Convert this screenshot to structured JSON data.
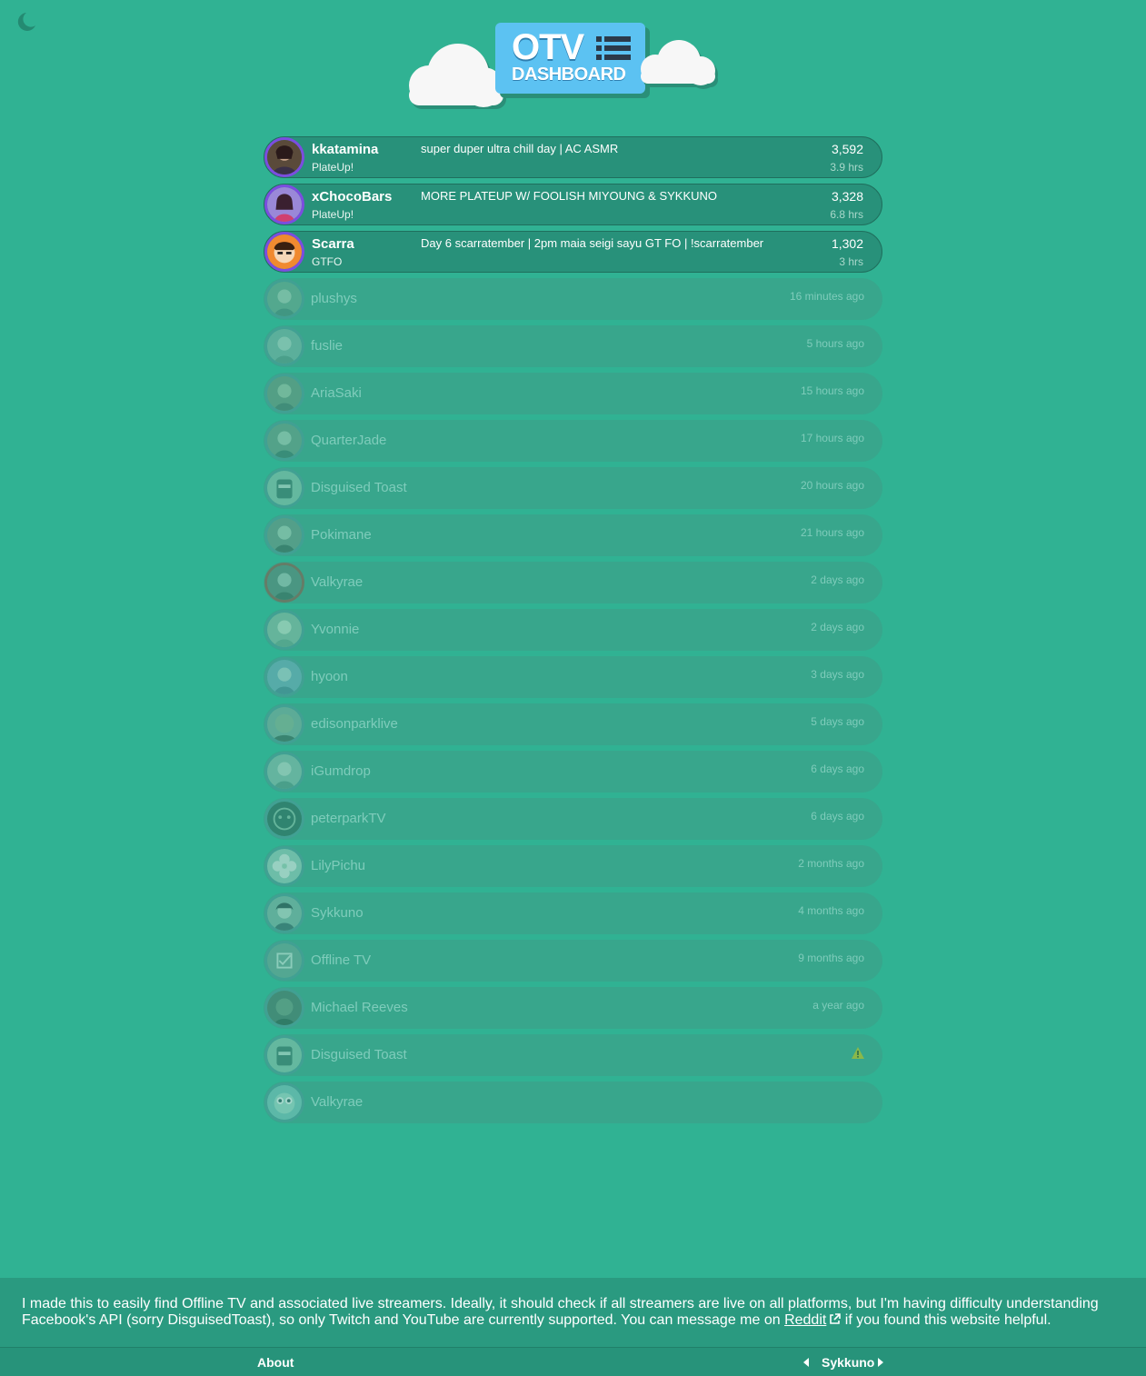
{
  "header": {
    "logo_line1": "OTV",
    "logo_line2": "DASHBOARD"
  },
  "live": [
    {
      "name": "kkatamina",
      "game": "PlateUp!",
      "title": "super duper ultra chill day | AC ASMR",
      "viewers": "3,592",
      "uptime": "3.9 hrs"
    },
    {
      "name": "xChocoBars",
      "game": "PlateUp!",
      "title": "MORE PLATEUP W/ FOOLISH MIYOUNG & SYKKUNO",
      "viewers": "3,328",
      "uptime": "6.8 hrs"
    },
    {
      "name": "Scarra",
      "game": "GTFO",
      "title": "Day 6 scarratember | 2pm maia seigi sayu GT FO | !scarratember",
      "viewers": "1,302",
      "uptime": "3 hrs"
    }
  ],
  "offline": [
    {
      "name": "plushys",
      "last_seen": "16 minutes ago"
    },
    {
      "name": "fuslie",
      "last_seen": "5 hours ago"
    },
    {
      "name": "AriaSaki",
      "last_seen": "15 hours ago"
    },
    {
      "name": "QuarterJade",
      "last_seen": "17 hours ago"
    },
    {
      "name": "Disguised Toast",
      "last_seen": "20 hours ago"
    },
    {
      "name": "Pokimane",
      "last_seen": "21 hours ago"
    },
    {
      "name": "Valkyrae",
      "last_seen": "2 days ago"
    },
    {
      "name": "Yvonnie",
      "last_seen": "2 days ago"
    },
    {
      "name": "hyoon",
      "last_seen": "3 days ago"
    },
    {
      "name": "edisonparklive",
      "last_seen": "5 days ago"
    },
    {
      "name": "iGumdrop",
      "last_seen": "6 days ago"
    },
    {
      "name": "peterparkTV",
      "last_seen": "6 days ago"
    },
    {
      "name": "LilyPichu",
      "last_seen": "2 months ago"
    },
    {
      "name": "Sykkuno",
      "last_seen": "4 months ago"
    },
    {
      "name": "Offline TV",
      "last_seen": "9 months ago"
    },
    {
      "name": "Michael Reeves",
      "last_seen": "a year ago"
    },
    {
      "name": "Disguised Toast",
      "last_seen": ""
    },
    {
      "name": "Valkyrae",
      "last_seen": ""
    }
  ],
  "footer": {
    "note_before": "I made this to easily find Offline TV and associated live streamers. Ideally, it should check if all streamers are live on all platforms, but I'm having difficulty understanding Facebook's API (sorry DisguisedToast), so only Twitch and YouTube are currently supported. You can message me on ",
    "note_link": "Reddit",
    "note_after": " if you found this website helpful.",
    "about_label": "About",
    "current_streamer": "Sykkuno"
  },
  "colors": {
    "background": "#30b293",
    "live_row": "#28917a",
    "offline_row": "#38a68c",
    "live_ring": "#7c4ce0",
    "logo": "#5cc2f2"
  },
  "icons": [
    "moon-icon",
    "list-icon",
    "warning-icon",
    "external-link-icon",
    "caret-left-icon",
    "caret-right-icon"
  ]
}
